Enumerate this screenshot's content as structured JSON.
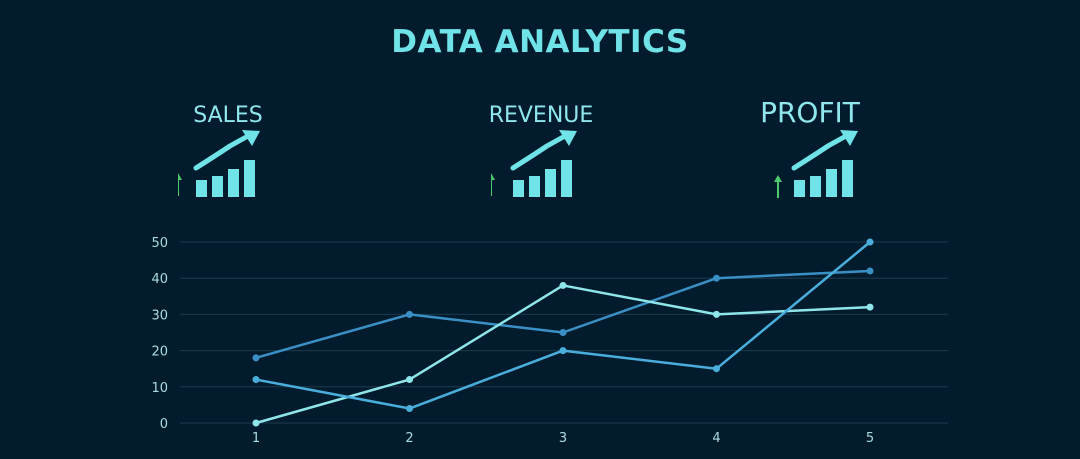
{
  "title": "DATA ANALYTICS",
  "kpis": [
    {
      "label": "SALES",
      "icon": "growth-bars-arrow-icon",
      "trend_icon": "up-arrow-icon"
    },
    {
      "label": "REVENUE",
      "icon": "growth-bars-arrow-icon",
      "trend_icon": "up-arrow-icon"
    },
    {
      "label": "PROFIT",
      "icon": "growth-bars-arrow-icon",
      "trend_icon": "up-arrow-icon"
    }
  ],
  "colors": {
    "background": "#031c2d",
    "title": "#6fe3e8",
    "icon": "#6fe3e8",
    "trend_up": "#4cc96a",
    "grid": "#1d3a4d",
    "series": [
      "#3a8fc4",
      "#8ee6ea",
      "#4aaedc"
    ]
  },
  "chart_data": {
    "type": "line",
    "x": [
      1,
      2,
      3,
      4,
      5
    ],
    "ylim": [
      0,
      50
    ],
    "yticks": [
      0,
      10,
      20,
      30,
      40,
      50
    ],
    "grid": true,
    "series": [
      {
        "values": [
          18,
          30,
          25,
          40,
          42
        ]
      },
      {
        "values": [
          0,
          12,
          38,
          30,
          32
        ]
      },
      {
        "values": [
          12,
          4,
          20,
          15,
          50
        ]
      }
    ]
  }
}
